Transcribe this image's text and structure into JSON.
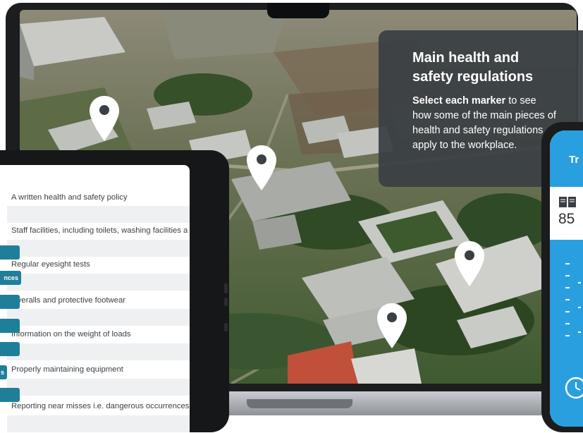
{
  "panel": {
    "title": "Main health and safety regulations",
    "body_bold": "Select each marker",
    "body_rest": " to see how some of the main pieces of health and safety regulations apply to the workplace."
  },
  "markers": [
    {
      "name": "marker-1"
    },
    {
      "name": "marker-2"
    },
    {
      "name": "marker-3"
    },
    {
      "name": "marker-4"
    }
  ],
  "tablet": {
    "questions": [
      "A written health and safety policy",
      "Staff facilities, including toilets, washing facilities a",
      "Regular eyesight tests",
      "Overalls and protective footwear",
      "Information on the weight of loads",
      "Properly maintaining equipment",
      "Reporting near misses i.e. dangerous occurrences"
    ],
    "tags": [
      "",
      "nces",
      "",
      "",
      "",
      "s",
      ""
    ]
  },
  "phone": {
    "title": "Tr",
    "number": "85"
  },
  "colors": {
    "panel_bg": "#3a4044",
    "teal": "#1f7f9a",
    "phone_blue": "#2a9fe0"
  }
}
